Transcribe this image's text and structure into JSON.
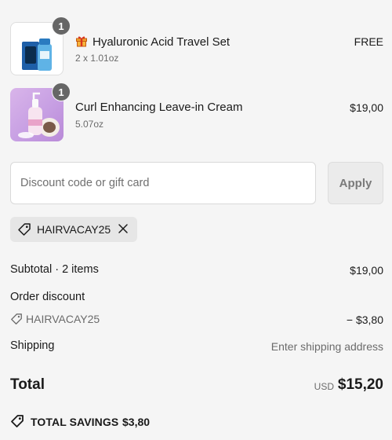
{
  "items": [
    {
      "name": "Hyaluronic Acid Travel Set",
      "size": "2 x 1.01oz",
      "price": "FREE",
      "quantity": "1",
      "icon": "gift-icon"
    },
    {
      "name": "Curl Enhancing Leave-in Cream",
      "size": "5.07oz",
      "price": "$19,00",
      "quantity": "1"
    }
  ],
  "discount": {
    "placeholder": "Discount code or gift card",
    "apply_label": "Apply",
    "applied_code": "HAIRVACAY25"
  },
  "summary": {
    "subtotal_label": "Subtotal · 2 items",
    "subtotal_value": "$19,00",
    "order_discount_label": "Order discount",
    "order_discount_code": "HAIRVACAY25",
    "order_discount_value": "− $3,80",
    "shipping_label": "Shipping",
    "shipping_value": "Enter shipping address",
    "total_label": "Total",
    "currency": "USD",
    "total_value": "$15,20",
    "savings_label": "TOTAL SAVINGS",
    "savings_value": "$3,80"
  },
  "colors": {
    "background": "#f5f5f5",
    "badge": "#666666",
    "muted_text": "#6b6b6b",
    "chip": "#e6e6e6"
  }
}
